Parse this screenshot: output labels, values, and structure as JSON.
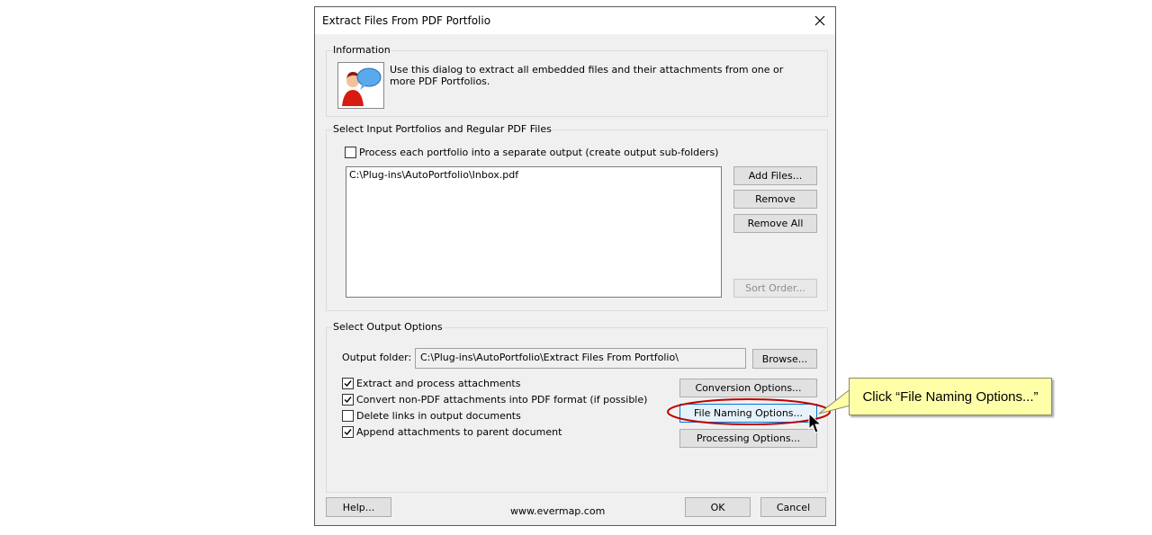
{
  "window": {
    "title": "Extract Files From PDF Portfolio"
  },
  "information": {
    "label": "Information",
    "text": "Use this dialog to extract all embedded files and their attachments from one or more PDF Portfolios."
  },
  "input": {
    "label": "Select Input Portfolios and Regular PDF Files",
    "separate_output_checkbox": {
      "label": "Process each portfolio into a separate output (create output sub-folders)",
      "checked": false
    },
    "files": [
      "C:\\Plug-ins\\AutoPortfolio\\Inbox.pdf"
    ],
    "add_files": "Add Files...",
    "remove": "Remove",
    "remove_all": "Remove All",
    "sort_order": "Sort Order..."
  },
  "output": {
    "label": "Select Output Options",
    "folder_label": "Output folder:",
    "folder_value": "C:\\Plug-ins\\AutoPortfolio\\Extract Files From Portfolio\\",
    "browse": "Browse...",
    "options": [
      {
        "label": "Extract and process attachments",
        "checked": true
      },
      {
        "label": "Convert non-PDF attachments into PDF format (if possible)",
        "checked": true
      },
      {
        "label": "Delete links in output documents",
        "checked": false
      },
      {
        "label": "Append attachments to parent document",
        "checked": true
      }
    ],
    "conversion_options": "Conversion Options...",
    "file_naming_options": "File Naming Options...",
    "processing_options": "Processing Options..."
  },
  "footer": {
    "help": "Help...",
    "website": "www.evermap.com",
    "ok": "OK",
    "cancel": "Cancel"
  },
  "callout": {
    "text": "Click “File Naming Options...”"
  },
  "colors": {
    "highlight_ellipse": "#c00000",
    "callout_bg": "#ffffa8",
    "focus_border": "#0078d7"
  }
}
